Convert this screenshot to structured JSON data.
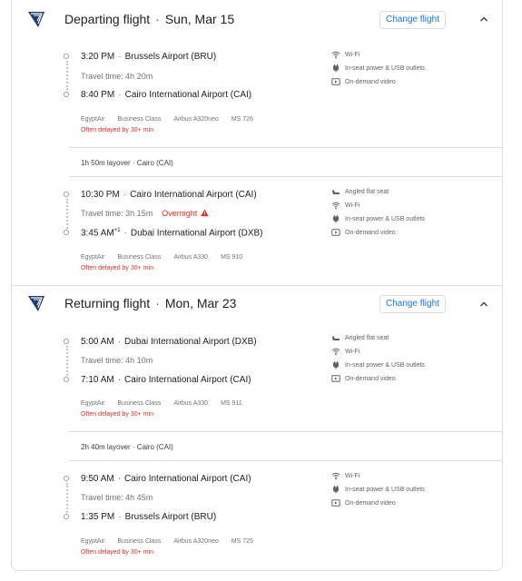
{
  "departing": {
    "title": "Departing flight",
    "date": "Sun, Mar 15",
    "change_label": "Change flight",
    "legs": [
      {
        "dep_time": "3:20 PM",
        "dep_airport": "Brussels Airport (BRU)",
        "travel_time": "Travel time: 4h 20m",
        "overnight": "",
        "arr_time": "8:40 PM",
        "arr_sup": "",
        "arr_airport": "Cairo International Airport (CAI)",
        "airline": "EgyptAir",
        "cabin": "Business Class",
        "aircraft": "Airbus A320neo",
        "flight_no": "MS 726",
        "delay": "Often delayed by 30+ min",
        "amenities": [
          "Wi-Fi",
          "In-seat power & USB outlets",
          "On-demand video"
        ]
      },
      {
        "dep_time": "10:30 PM",
        "dep_airport": "Cairo International Airport (CAI)",
        "travel_time": "Travel time: 3h 15m",
        "overnight": "Overnight",
        "arr_time": "3:45 AM",
        "arr_sup": "+1",
        "arr_airport": "Dubai International Airport (DXB)",
        "airline": "EgyptAir",
        "cabin": "Business Class",
        "aircraft": "Airbus A330",
        "flight_no": "MS 910",
        "delay": "Often delayed by 30+ min",
        "amenities": [
          "Angled flat seat",
          "Wi-Fi",
          "In-seat power & USB outlets",
          "On-demand video"
        ]
      }
    ],
    "layover": "1h 50m layover · Cairo (CAI)"
  },
  "returning": {
    "title": "Returning flight",
    "date": "Mon, Mar 23",
    "change_label": "Change flight",
    "legs": [
      {
        "dep_time": "5:00 AM",
        "dep_airport": "Dubai International Airport (DXB)",
        "travel_time": "Travel time: 4h 10m",
        "overnight": "",
        "arr_time": "7:10 AM",
        "arr_sup": "",
        "arr_airport": "Cairo International Airport (CAI)",
        "airline": "EgyptAir",
        "cabin": "Business Class",
        "aircraft": "Airbus A330",
        "flight_no": "MS 911",
        "delay": "Often delayed by 30+ min",
        "amenities": [
          "Angled flat seat",
          "Wi-Fi",
          "In-seat power & USB outlets",
          "On-demand video"
        ]
      },
      {
        "dep_time": "9:50 AM",
        "dep_airport": "Cairo International Airport (CAI)",
        "travel_time": "Travel time: 4h 45m",
        "overnight": "",
        "arr_time": "1:35 PM",
        "arr_sup": "",
        "arr_airport": "Brussels Airport (BRU)",
        "airline": "EgyptAir",
        "cabin": "Business Class",
        "aircraft": "Airbus A320neo",
        "flight_no": "MS 725",
        "delay": "Often delayed by 30+ min",
        "amenities": [
          "Wi-Fi",
          "In-seat power & USB outlets",
          "On-demand video"
        ]
      }
    ],
    "layover": "2h 40m layover · Cairo (CAI)"
  },
  "icons": {
    "logo": "egyptair-logo-icon",
    "chevron": "chevron-up-icon",
    "Angled flat seat": "seat-icon",
    "Wi-Fi": "wifi-icon",
    "In-seat power & USB outlets": "power-plug-icon",
    "On-demand video": "video-icon",
    "warning": "warning-icon"
  },
  "colors": {
    "link": "#1a73e8",
    "delay": "#d93025",
    "muted": "#70757a",
    "border": "#dadce0",
    "logo": "#1f3a6b"
  }
}
